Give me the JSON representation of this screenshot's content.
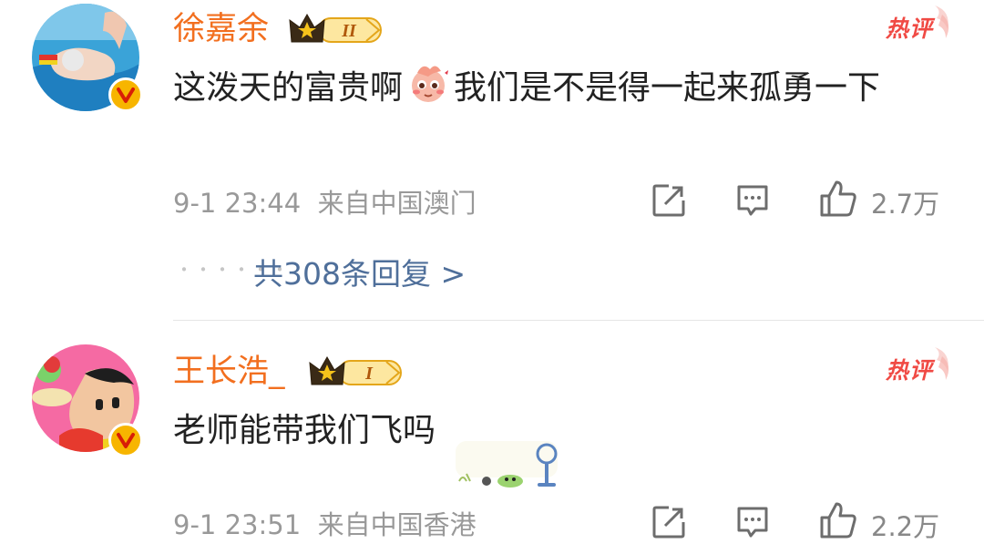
{
  "comments": [
    {
      "username": "徐嘉余",
      "medal_level": "II",
      "hot_label": "热评",
      "text_before": "这泼天的富贵啊",
      "text_after": "我们是不是得一起来孤勇一下",
      "timestamp": "9-1 23:44",
      "location": "来自中国澳门",
      "likes": "2.7万",
      "replies_link": "共308条回复 >"
    },
    {
      "username": "王长浩_",
      "medal_level": "I",
      "hot_label": "热评",
      "text": "老师能带我们飞吗",
      "timestamp": "9-1 23:51",
      "location": "来自中国香港",
      "likes": "2.2万"
    }
  ],
  "colors": {
    "username": "#f26f1f",
    "link": "#4f6f9a",
    "meta": "#999999",
    "hot": "#f04a44",
    "badge": "#f7b500"
  }
}
